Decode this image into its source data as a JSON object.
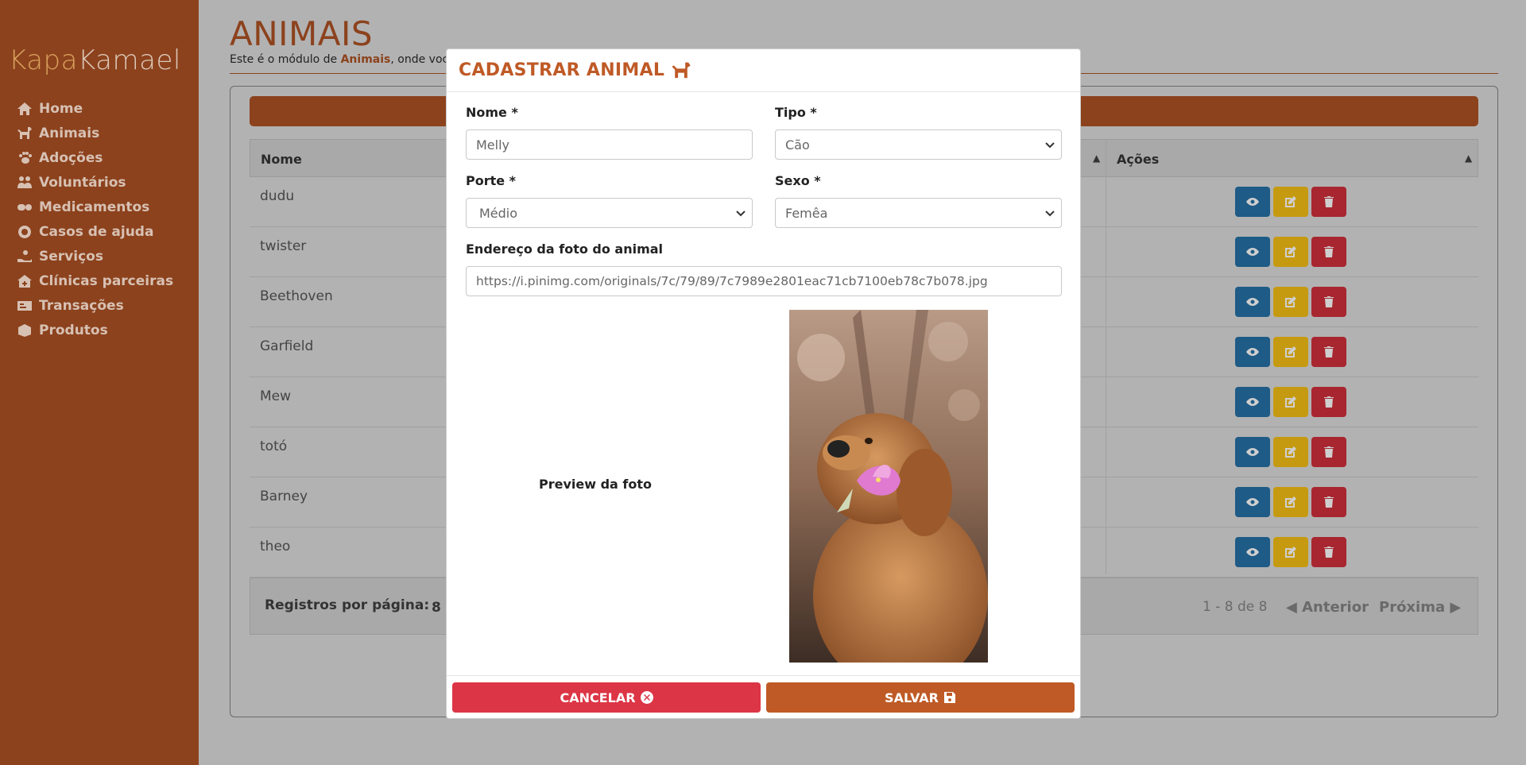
{
  "app": {
    "brand_part1": "Kapa",
    "brand_part2": "Kamael"
  },
  "sidebar": {
    "items": [
      {
        "label": "Home",
        "icon": "home-icon"
      },
      {
        "label": "Animais",
        "icon": "dog-icon"
      },
      {
        "label": "Adoções",
        "icon": "paw-icon"
      },
      {
        "label": "Voluntários",
        "icon": "people-icon"
      },
      {
        "label": "Medicamentos",
        "icon": "pills-icon"
      },
      {
        "label": "Casos de ajuda",
        "icon": "lifering-icon"
      },
      {
        "label": "Serviços",
        "icon": "hand-icon"
      },
      {
        "label": "Clínicas parceiras",
        "icon": "clinic-icon"
      },
      {
        "label": "Transações",
        "icon": "money-icon"
      },
      {
        "label": "Produtos",
        "icon": "box-icon"
      }
    ]
  },
  "page": {
    "title": "ANIMAIS",
    "subtitle_prefix": "Este é o módulo de ",
    "subtitle_bold": "Animais",
    "subtitle_suffix": ", onde voc"
  },
  "table": {
    "col_name": "Nome",
    "col_actions": "Ações",
    "rows": [
      {
        "name": "dudu"
      },
      {
        "name": "twister"
      },
      {
        "name": "Beethoven"
      },
      {
        "name": "Garfield"
      },
      {
        "name": "Mew"
      },
      {
        "name": "totó"
      },
      {
        "name": "Barney"
      },
      {
        "name": "theo"
      }
    ],
    "footer": {
      "rows_per_page_label": "Registros por página:",
      "rows_per_page_value": "8",
      "range": "1 - 8 de 8",
      "prev": "Anterior",
      "next": "Próxima"
    }
  },
  "modal": {
    "title": "CADASTRAR ANIMAL",
    "fields": {
      "nome_label": "Nome *",
      "nome_value": "Melly",
      "tipo_label": "Tipo *",
      "tipo_value": "Cão",
      "porte_label": "Porte *",
      "porte_value": "Médio",
      "sexo_label": "Sexo *",
      "sexo_value": "Femêa",
      "foto_label": "Endereço da foto do animal",
      "foto_value": "https://i.pinimg.com/originals/7c/79/89/7c7989e2801eac71cb7100eb78c7b078.jpg"
    },
    "preview_label": "Preview da foto",
    "cancel_label": "CANCELAR",
    "save_label": "SALVAR"
  },
  "colors": {
    "brand": "#8c421d",
    "accent": "#bf5a26",
    "danger": "#dc3545",
    "view": "#1e5b86",
    "edit": "#c69a10",
    "delete": "#a8262f"
  }
}
